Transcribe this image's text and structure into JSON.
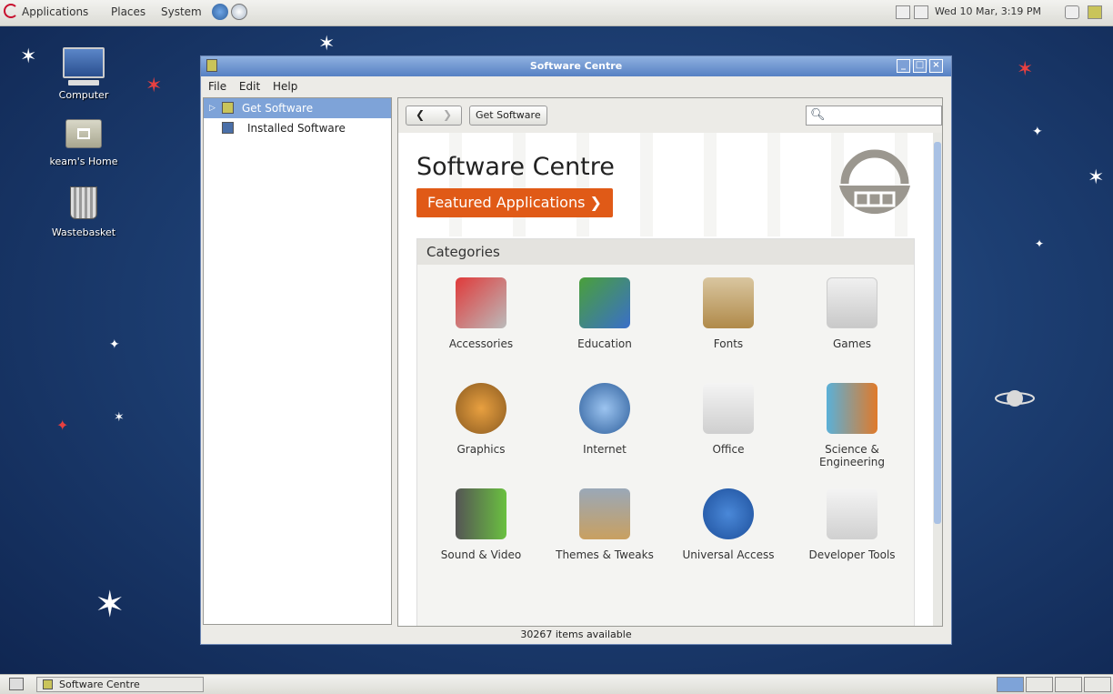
{
  "top_panel": {
    "menus": [
      "Applications",
      "Places",
      "System"
    ],
    "clock": "Wed 10 Mar, 3:19 PM"
  },
  "desktop": {
    "icons": [
      {
        "label": "Computer"
      },
      {
        "label": "keam's Home"
      },
      {
        "label": "Wastebasket"
      }
    ]
  },
  "window": {
    "title": "Software Centre",
    "menus": [
      "File",
      "Edit",
      "Help"
    ],
    "sidebar": [
      {
        "label": "Get Software"
      },
      {
        "label": "Installed Software"
      }
    ],
    "toolbar": {
      "breadcrumb": "Get Software",
      "search_value": ""
    },
    "banner": {
      "title": "Software Centre",
      "featured_label": "Featured Applications ❯"
    },
    "categories_header": "Categories",
    "categories": [
      "Accessories",
      "Education",
      "Fonts",
      "Games",
      "Graphics",
      "Internet",
      "Office",
      "Science & Engineering",
      "Sound & Video",
      "Themes & Tweaks",
      "Universal Access",
      "Developer Tools"
    ],
    "status": "30267 items available"
  },
  "taskbar": {
    "task_label": "Software Centre"
  },
  "colors": {
    "accent": "#e05a17",
    "selection": "#7ea3d8",
    "titlebar": "#5680c3"
  }
}
